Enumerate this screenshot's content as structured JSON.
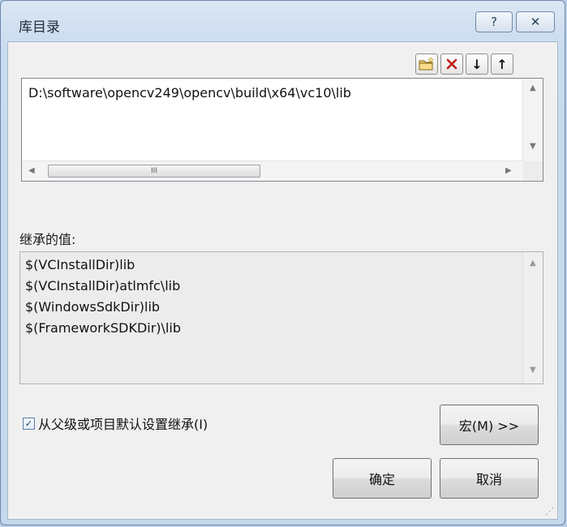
{
  "window": {
    "title": "库目录",
    "help_glyph": "?",
    "close_glyph": "✕"
  },
  "toolbar": {
    "new_line_icon": "folder-new-icon",
    "delete_icon": "delete-icon",
    "move_down_glyph": "↓",
    "move_up_glyph": "↑"
  },
  "directories": {
    "values": [
      "D:\\software\\opencv249\\opencv\\build\\x64\\vc10\\lib"
    ],
    "hscroll_thumb_glyph": "III"
  },
  "inherited": {
    "label": "继承的值:",
    "values": [
      "$(VCInstallDir)lib",
      "$(VCInstallDir)atlmfc\\lib",
      "$(WindowsSdkDir)lib",
      "$(FrameworkSDKDir)\\lib"
    ]
  },
  "inherit_checkbox": {
    "checked": true,
    "check_glyph": "✓",
    "label": "从父级或项目默认设置继承(I)"
  },
  "buttons": {
    "macro": "宏(M) >>",
    "ok": "确定",
    "cancel": "取消"
  },
  "colors": {
    "title_bar": "#cfdff0",
    "client_bg": "#f0f0f0",
    "accent_border": "#6b86a8"
  }
}
